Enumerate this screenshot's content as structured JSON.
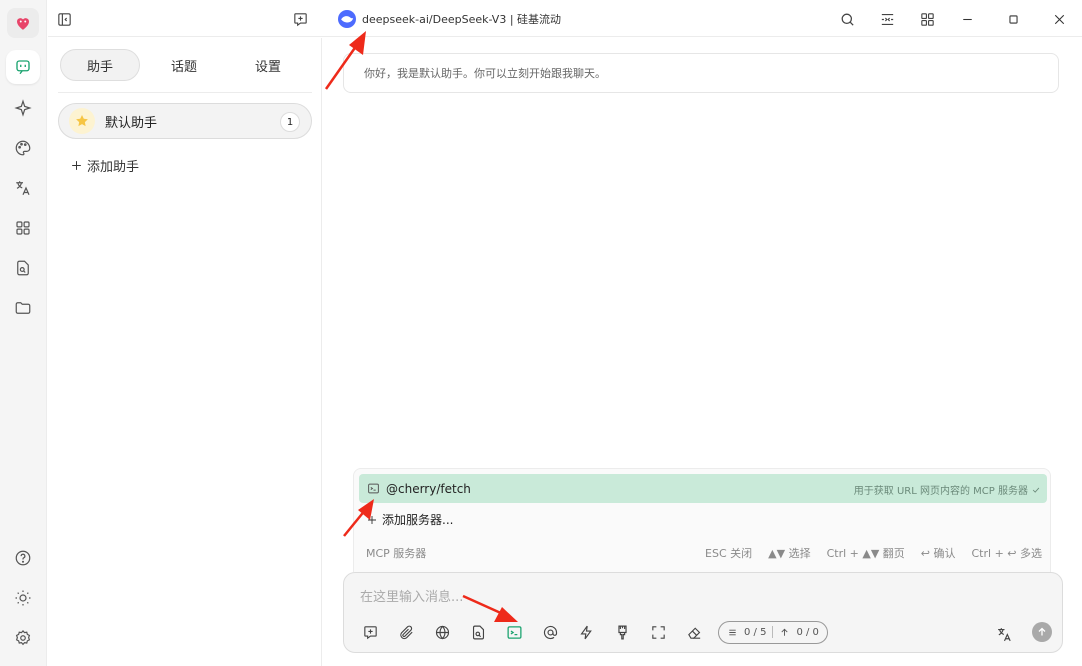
{
  "colors": {
    "accent": "#1aa36f",
    "arrow": "#ee2a1a",
    "mcp_highlight": "#c9ead9"
  },
  "rail": {
    "items": [
      {
        "name": "chat-icon",
        "active": true
      },
      {
        "name": "sparkle-icon"
      },
      {
        "name": "palette-icon"
      },
      {
        "name": "translate-icon"
      },
      {
        "name": "apps-grid-icon"
      },
      {
        "name": "file-search-icon"
      },
      {
        "name": "folder-icon"
      }
    ],
    "bottom": [
      {
        "name": "help-icon"
      },
      {
        "name": "theme-sun-icon"
      },
      {
        "name": "settings-gear-icon"
      }
    ]
  },
  "topbar": {
    "model_label": "deepseek-ai/DeepSeek-V3 | 硅基流动"
  },
  "panel": {
    "tabs": [
      {
        "label": "助手",
        "active": true
      },
      {
        "label": "话题"
      },
      {
        "label": "设置"
      }
    ],
    "assistant": {
      "name": "默认助手",
      "count": "1"
    },
    "add_assistant": "添加助手"
  },
  "main": {
    "greeting": "你好，我是默认助手。你可以立刻开始跟我聊天。",
    "mcp": {
      "server_name": "@cherry/fetch",
      "server_desc": "用于获取 URL 网页内容的 MCP 服务器",
      "add_server": "添加服务器...",
      "footer_label": "MCP 服务器",
      "hints": [
        "ESC 关闭",
        "▲▼ 选择",
        "Ctrl + ▲▼ 翻页",
        "↩ 确认",
        "Ctrl + ↩ 多选"
      ]
    },
    "composer": {
      "placeholder": "在这里输入消息...",
      "tokens_context": "0 / 5",
      "tokens_up": "0 / 0"
    }
  }
}
